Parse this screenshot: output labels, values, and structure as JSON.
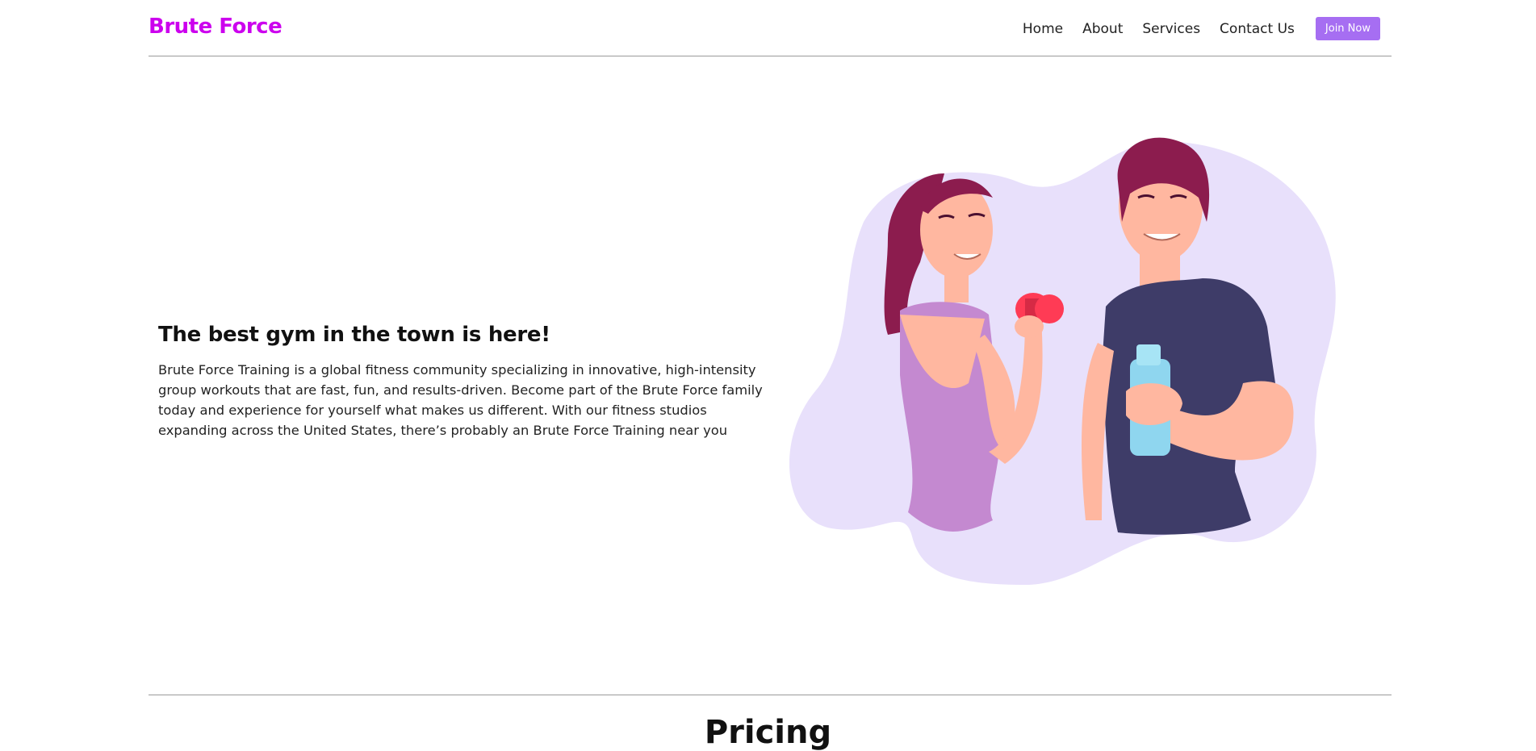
{
  "brand": {
    "name": "Brute Force",
    "color": "#cc00ee"
  },
  "nav": {
    "links": [
      "Home",
      "About",
      "Services",
      "Contact Us"
    ],
    "cta_label": "Join Now",
    "cta_color": "#a66ef2"
  },
  "hero": {
    "title": "The best gym in the town is here!",
    "description": "Brute Force Training is a global fitness community specializing in innovative, high-intensity group workouts that are fast, fun, and results-driven. Become part of the Brute Force family today and experience for yourself what makes us different. With our fitness studios expanding across the United States, there’s probably an Brute Force Training near you",
    "illustration": "woman-with-dumbbell-and-man-with-water-bottle"
  },
  "pricing": {
    "title": "Pricing"
  }
}
